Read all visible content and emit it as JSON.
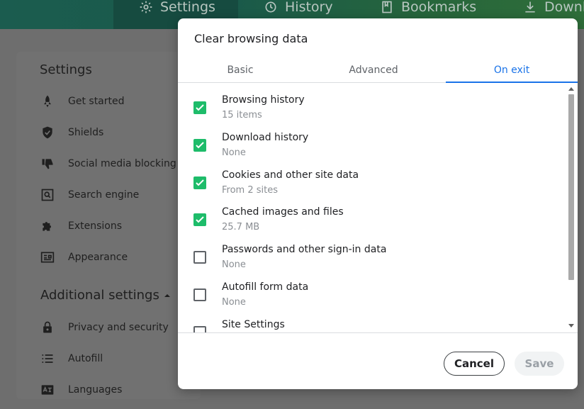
{
  "topnav": {
    "tabs": [
      {
        "label": "Settings",
        "icon": "gear-icon"
      },
      {
        "label": "History",
        "icon": "history-icon"
      },
      {
        "label": "Bookmarks",
        "icon": "bookmark-icon"
      },
      {
        "label": "Downl",
        "icon": "download-icon"
      }
    ]
  },
  "sidebar": {
    "title": "Settings",
    "items": [
      {
        "label": "Get started",
        "icon": "rocket-icon"
      },
      {
        "label": "Shields",
        "icon": "shield-icon"
      },
      {
        "label": "Social media blocking",
        "icon": "thumbs-down-icon"
      },
      {
        "label": "Search engine",
        "icon": "search-engine-icon"
      },
      {
        "label": "Extensions",
        "icon": "puzzle-icon"
      },
      {
        "label": "Appearance",
        "icon": "appearance-icon"
      }
    ],
    "additional_label": "Additional settings",
    "additional_items": [
      {
        "label": "Privacy and security",
        "icon": "lock-icon"
      },
      {
        "label": "Autofill",
        "icon": "list-icon"
      },
      {
        "label": "Languages",
        "icon": "languages-icon"
      }
    ]
  },
  "dialog": {
    "title": "Clear browsing data",
    "tabs": [
      "Basic",
      "Advanced",
      "On exit"
    ],
    "selected_tab": "On exit",
    "items": [
      {
        "title": "Browsing history",
        "subtitle": "15 items",
        "checked": true
      },
      {
        "title": "Download history",
        "subtitle": "None",
        "checked": true
      },
      {
        "title": "Cookies and other site data",
        "subtitle": "From 2 sites",
        "checked": true
      },
      {
        "title": "Cached images and files",
        "subtitle": "25.7 MB",
        "checked": true
      },
      {
        "title": "Passwords and other sign-in data",
        "subtitle": "None",
        "checked": false
      },
      {
        "title": "Autofill form data",
        "subtitle": "None",
        "checked": false
      },
      {
        "title": "Site Settings",
        "subtitle": "",
        "checked": false
      }
    ],
    "cancel_label": "Cancel",
    "save_label": "Save"
  },
  "colors": {
    "checkbox_checked": "#1ebc6a",
    "accent": "#1a73e8",
    "topbar": "#1b5c4f"
  }
}
